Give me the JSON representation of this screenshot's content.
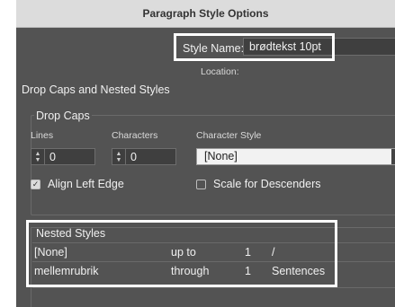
{
  "window": {
    "title": "Paragraph Style Options"
  },
  "style_name": {
    "label": "Style Name:",
    "value": "brødtekst 10pt"
  },
  "location": {
    "label": "Location:"
  },
  "panel_title": "Drop Caps and Nested Styles",
  "drop_caps": {
    "title": "Drop Caps",
    "lines_label": "Lines",
    "lines_value": "0",
    "characters_label": "Characters",
    "characters_value": "0",
    "character_style_label": "Character Style",
    "character_style_value": "[None]",
    "align_left_edge": {
      "label": "Align Left Edge",
      "checked": true
    },
    "scale_for_descenders": {
      "label": "Scale for Descenders",
      "checked": false
    }
  },
  "nested_styles": {
    "title": "Nested Styles",
    "rows": [
      {
        "style": "[None]",
        "relation": "up to",
        "count": "1",
        "unit": "/"
      },
      {
        "style": "mellemrubrik",
        "relation": "through",
        "count": "1",
        "unit": "Sentences"
      }
    ]
  }
}
